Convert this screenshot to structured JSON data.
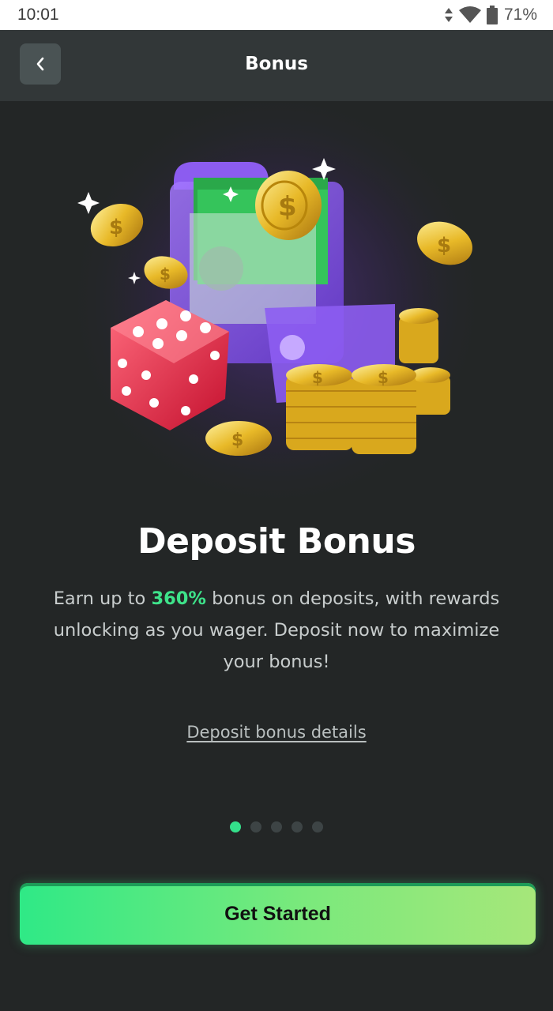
{
  "status_bar": {
    "time": "10:01",
    "battery": "71%"
  },
  "header": {
    "title": "Bonus"
  },
  "promo": {
    "title": "Deposit Bonus",
    "desc_pre": "Earn up to ",
    "desc_highlight": "360%",
    "desc_post": " bonus on deposits, with rewards unlocking as you wager. Deposit now to maximize your bonus!",
    "details_link": "Deposit bonus details"
  },
  "pager": {
    "total": 5,
    "active_index": 0
  },
  "cta": {
    "label": "Get Started"
  },
  "colors": {
    "accent_green": "#3ee38a",
    "background": "#232626",
    "header": "#323738"
  }
}
